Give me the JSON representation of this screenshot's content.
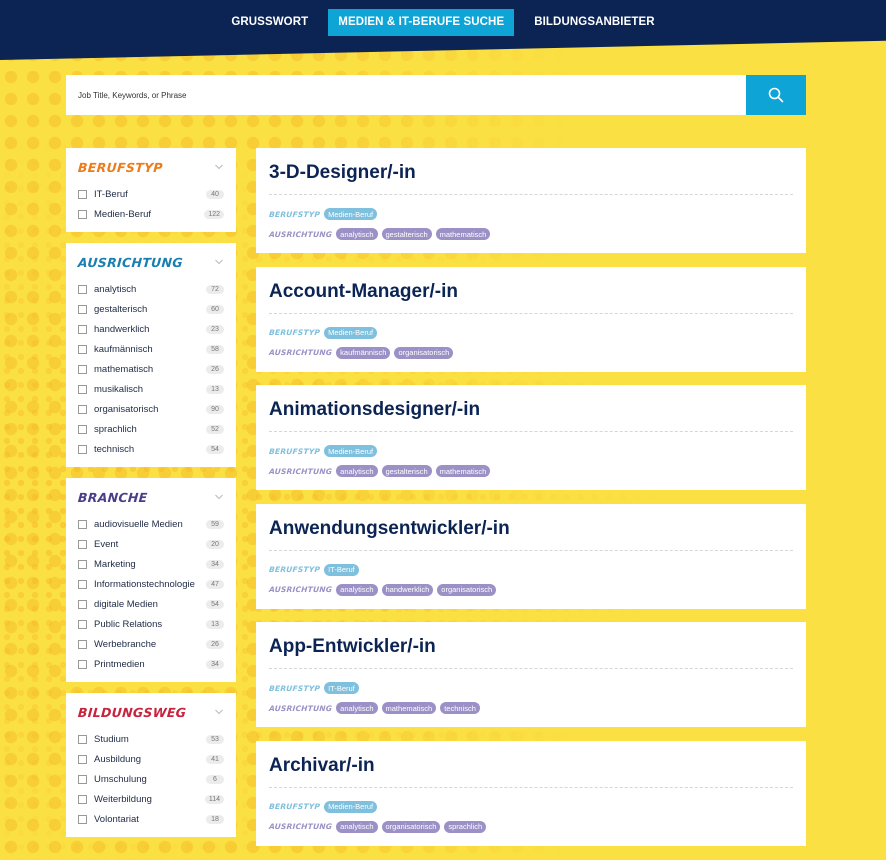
{
  "nav": [
    {
      "label": "GRUSSWORT",
      "active": false
    },
    {
      "label": "MEDIEN & IT-BERUFE SUCHE",
      "active": true
    },
    {
      "label": "BILDUNGSANBIETER",
      "active": false
    }
  ],
  "search": {
    "placeholder": "Job Title, Keywords, or Phrase",
    "icon": "search-icon"
  },
  "colors": {
    "navy": "#0b2454",
    "accent": "#0fa4d6",
    "yellow": "#fbe044"
  },
  "filters": [
    {
      "title": "BERUFSTYP",
      "color": "orange",
      "options": [
        {
          "label": "IT-Beruf",
          "count": "40"
        },
        {
          "label": "Medien-Beruf",
          "count": "122"
        }
      ]
    },
    {
      "title": "AUSRICHTUNG",
      "color": "teal",
      "options": [
        {
          "label": "analytisch",
          "count": "72"
        },
        {
          "label": "gestalterisch",
          "count": "60"
        },
        {
          "label": "handwerklich",
          "count": "23"
        },
        {
          "label": "kaufmännisch",
          "count": "58"
        },
        {
          "label": "mathematisch",
          "count": "26"
        },
        {
          "label": "musikalisch",
          "count": "13"
        },
        {
          "label": "organisatorisch",
          "count": "90"
        },
        {
          "label": "sprachlich",
          "count": "52"
        },
        {
          "label": "technisch",
          "count": "54"
        }
      ]
    },
    {
      "title": "BRANCHE",
      "color": "purple",
      "options": [
        {
          "label": "audiovisuelle Medien",
          "count": "59"
        },
        {
          "label": "Event",
          "count": "20"
        },
        {
          "label": "Marketing",
          "count": "34"
        },
        {
          "label": "Informationstechnologie",
          "count": "47"
        },
        {
          "label": "digitale Medien",
          "count": "54"
        },
        {
          "label": "Public Relations",
          "count": "13"
        },
        {
          "label": "Werbebranche",
          "count": "26"
        },
        {
          "label": "Printmedien",
          "count": "34"
        }
      ]
    },
    {
      "title": "BILDUNGSWEG",
      "color": "red",
      "options": [
        {
          "label": "Studium",
          "count": "53"
        },
        {
          "label": "Ausbildung",
          "count": "41"
        },
        {
          "label": "Umschulung",
          "count": "6"
        },
        {
          "label": "Weiterbildung",
          "count": "114"
        },
        {
          "label": "Volontariat",
          "count": "18"
        }
      ]
    }
  ],
  "labels": {
    "type": "BERUFSTYP",
    "direction": "AUSRICHTUNG"
  },
  "jobs": [
    {
      "title": "3-D-Designer/-in",
      "type": [
        "Medien-Beruf"
      ],
      "direction": [
        "analytisch",
        "gestalterisch",
        "mathematisch"
      ]
    },
    {
      "title": "Account-Manager/-in",
      "type": [
        "Medien-Beruf"
      ],
      "direction": [
        "kaufmännisch",
        "organisatorisch"
      ]
    },
    {
      "title": "Animationsdesigner/-in",
      "type": [
        "Medien-Beruf"
      ],
      "direction": [
        "analytisch",
        "gestalterisch",
        "mathematisch"
      ]
    },
    {
      "title": "Anwendungsentwickler/-in",
      "type": [
        "IT-Beruf"
      ],
      "direction": [
        "analytisch",
        "handwerklich",
        "organisatorisch"
      ]
    },
    {
      "title": "App-Entwickler/-in",
      "type": [
        "IT-Beruf"
      ],
      "direction": [
        "analytisch",
        "mathematisch",
        "technisch"
      ]
    },
    {
      "title": "Archivar/-in",
      "type": [
        "Medien-Beruf"
      ],
      "direction": [
        "analytisch",
        "organisatorisch",
        "sprachlich"
      ]
    }
  ]
}
